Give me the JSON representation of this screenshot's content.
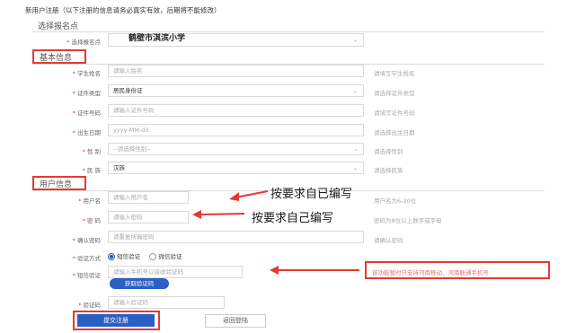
{
  "header": {
    "title": "新用户注册（以下注册的信息请务必真实有效，后期将不能修改）"
  },
  "section_school": {
    "title": "选择报名点"
  },
  "school": {
    "label": "选择报名点",
    "value": "鹤壁市淇滨小学"
  },
  "section_basic": {
    "title": "基本信息"
  },
  "basic": {
    "name": {
      "label": "学生姓名",
      "placeholder": "请输入姓名",
      "hint": "请填写学生姓名"
    },
    "id_type": {
      "label": "证件类型",
      "value": "居民身份证",
      "hint": "请选择证件类型"
    },
    "id_number": {
      "label": "证件号码",
      "placeholder": "请输入证件号码",
      "hint": "请填写证件号码"
    },
    "birth": {
      "label": "出生日期",
      "placeholder": "yyyy-MM-dd",
      "hint": "请选择出生日期"
    },
    "gender": {
      "label": "性 别",
      "value": "--请选择性别--",
      "hint": "请选择性别"
    },
    "ethnic": {
      "label": "民 族",
      "value": "汉族",
      "hint": "请选择民族"
    }
  },
  "section_user": {
    "title": "用户信息"
  },
  "user": {
    "username": {
      "label": "用户名",
      "placeholder": "请输入用户名",
      "hint": "用户名为6-20位"
    },
    "password": {
      "label": "密 码",
      "placeholder": "请输入密码",
      "hint": "密码为8位以上数字或字母"
    },
    "confirm": {
      "label": "确认密码",
      "placeholder": "请重复所输密码",
      "hint": "请确认密码"
    },
    "verify_method": {
      "label": "验证方式",
      "option_sms": "短信验证",
      "option_wechat": "微信验证"
    },
    "sms": {
      "label": "短信验证",
      "placeholder": "请输入手机号以接收验证码",
      "get_code": "获取验证码",
      "hint": "该功能暂时只支持河南移动、河南联通手机号"
    },
    "captcha": {
      "label": "验证码",
      "placeholder": "请输入验证码"
    }
  },
  "actions": {
    "submit": "提交注册",
    "back": "返回登陆"
  },
  "annotations": {
    "username_note": "按要求自已编写",
    "password_note": "按要求自己编写"
  },
  "colors": {
    "annotation_red": "#e53935",
    "primary_blue": "#2a5fc4"
  }
}
